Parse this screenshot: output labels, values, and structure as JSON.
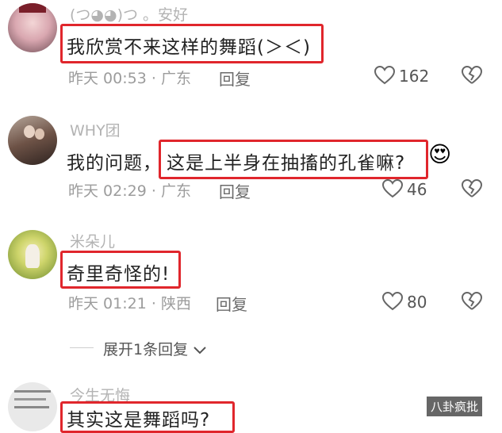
{
  "comments": [
    {
      "username": "(つ◕◕)つ 。安好",
      "content": "我欣赏不来这样的舞蹈(＞＜)",
      "time": "昨天 00:53",
      "location": "广东",
      "reply_label": "回复",
      "likes": "162"
    },
    {
      "username": "WHY团",
      "content_prefix": "我的问题，",
      "content": "这是上半身在抽搐的孔雀嘛?",
      "emoji": "😍",
      "time": "昨天 02:29",
      "location": "广东",
      "reply_label": "回复",
      "likes": "46"
    },
    {
      "username": "米朵儿",
      "content": "奇里奇怪的!",
      "time": "昨天 01:21",
      "location": "陕西",
      "reply_label": "回复",
      "likes": "80"
    },
    {
      "username": "今生无悔",
      "content": "其实这是舞蹈吗?"
    }
  ],
  "expand_replies": {
    "label": "展开1条回复"
  },
  "separator": "·",
  "watermark": "八卦疯批",
  "colors": {
    "highlight": "#e0262c",
    "meta": "#9c9c9c",
    "username": "#b3b3b3"
  }
}
